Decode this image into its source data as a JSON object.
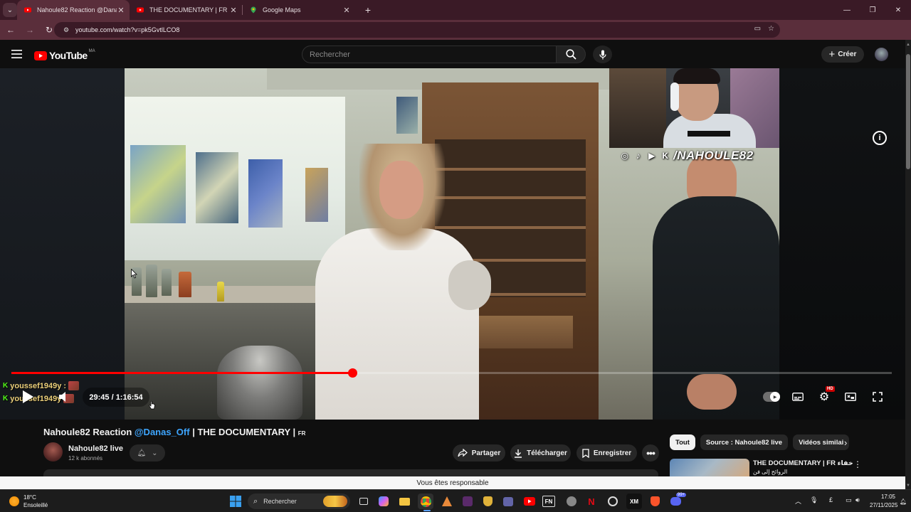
{
  "browser": {
    "tabs": [
      {
        "title": "Nahoule82 Reaction @Danas_O",
        "active": true
      },
      {
        "title": "THE DOCUMENTARY | FR من إخفاء",
        "active": false
      },
      {
        "title": "Google Maps",
        "active": false
      }
    ],
    "url": "youtube.com/watch?v=pk5GvtlLCO8",
    "profile_initial": "M"
  },
  "youtube": {
    "logo_text": "YouTube",
    "country_code": "MA",
    "search_placeholder": "Rechercher",
    "create_label": "Créer"
  },
  "player": {
    "overlay_handle": "/NAHOULE82",
    "chat": [
      {
        "user": "youssef1949y",
        "sep": ":"
      },
      {
        "user": "youssef1949y",
        "sep": ""
      }
    ],
    "current_time": "29:45",
    "duration": "1:16:54",
    "time_display": "29:45 / 1:16:54",
    "progress_fraction": 0.387,
    "quality_badge": "HD"
  },
  "video": {
    "title_prefix": "Nahoule82 Reaction ",
    "title_mention": "@Danas_Off",
    "title_suffix": " | THE DOCUMENTARY | ",
    "title_lang": "FR",
    "channel_name": "Nahoule82 live",
    "subscribers": "12 k abonnés",
    "actions": {
      "share": "Partager",
      "download": "Télécharger",
      "save": "Enregistrer"
    }
  },
  "sidebar": {
    "chips": [
      "Tout",
      "Source : Nahoule82 live",
      "Vidéos similai"
    ],
    "recommendation": {
      "title": "THE DOCUMENTARY | FR من إخفاء",
      "subtitle": "الروائح إلى فن"
    }
  },
  "notice": "Vous êtes responsable",
  "taskbar": {
    "weather_temp": "18°C",
    "weather_desc": "Ensoleillé",
    "search_label": "Rechercher",
    "lang": "£",
    "time": "17:05",
    "date": "27/11/2025",
    "badge_count": "99+"
  },
  "colors": {
    "brand_red": "#ff0000",
    "mention_blue": "#3ea6ff",
    "kick_green": "#53fc18",
    "browser_frame": "#5a2e3b"
  }
}
